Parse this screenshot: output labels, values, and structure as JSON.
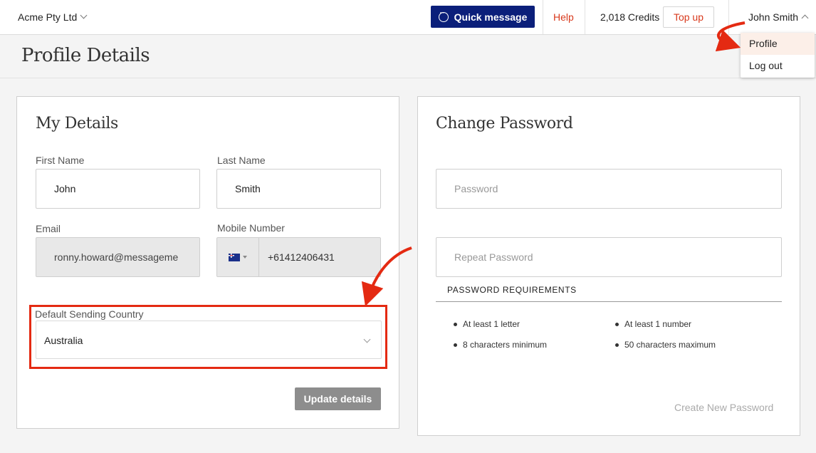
{
  "header": {
    "company": "Acme Pty Ltd",
    "quick_message": "Quick message",
    "help": "Help",
    "credits": "2,018 Credits",
    "top_up": "Top up",
    "user": "John Smith",
    "user_menu": [
      "Profile",
      "Log out"
    ]
  },
  "page": {
    "title": "Profile Details"
  },
  "my_details": {
    "title": "My Details",
    "first_name_label": "First Name",
    "first_name_value": "John",
    "last_name_label": "Last Name",
    "last_name_value": "Smith",
    "email_label": "Email",
    "email_value": "ronny.howard@messageme",
    "mobile_label": "Mobile Number",
    "mobile_value": "+61412406431",
    "country_label": "Default Sending Country",
    "country_value": "Australia",
    "update_button": "Update details"
  },
  "change_password": {
    "title": "Change Password",
    "password_placeholder": "Password",
    "repeat_placeholder": "Repeat Password",
    "requirements_title": "PASSWORD REQUIREMENTS",
    "requirements": [
      "At least 1 letter",
      "At least 1 number",
      "8 characters minimum",
      "50 characters maximum"
    ],
    "create_button": "Create New Password"
  },
  "colors": {
    "brand_navy": "#0b1f7a",
    "accent_red": "#e42a12",
    "link_red": "#d8391c"
  },
  "icons": {
    "chat": "chat-bubble-icon",
    "flag": "australia-flag-icon",
    "chevron": "chevron-down-icon"
  }
}
